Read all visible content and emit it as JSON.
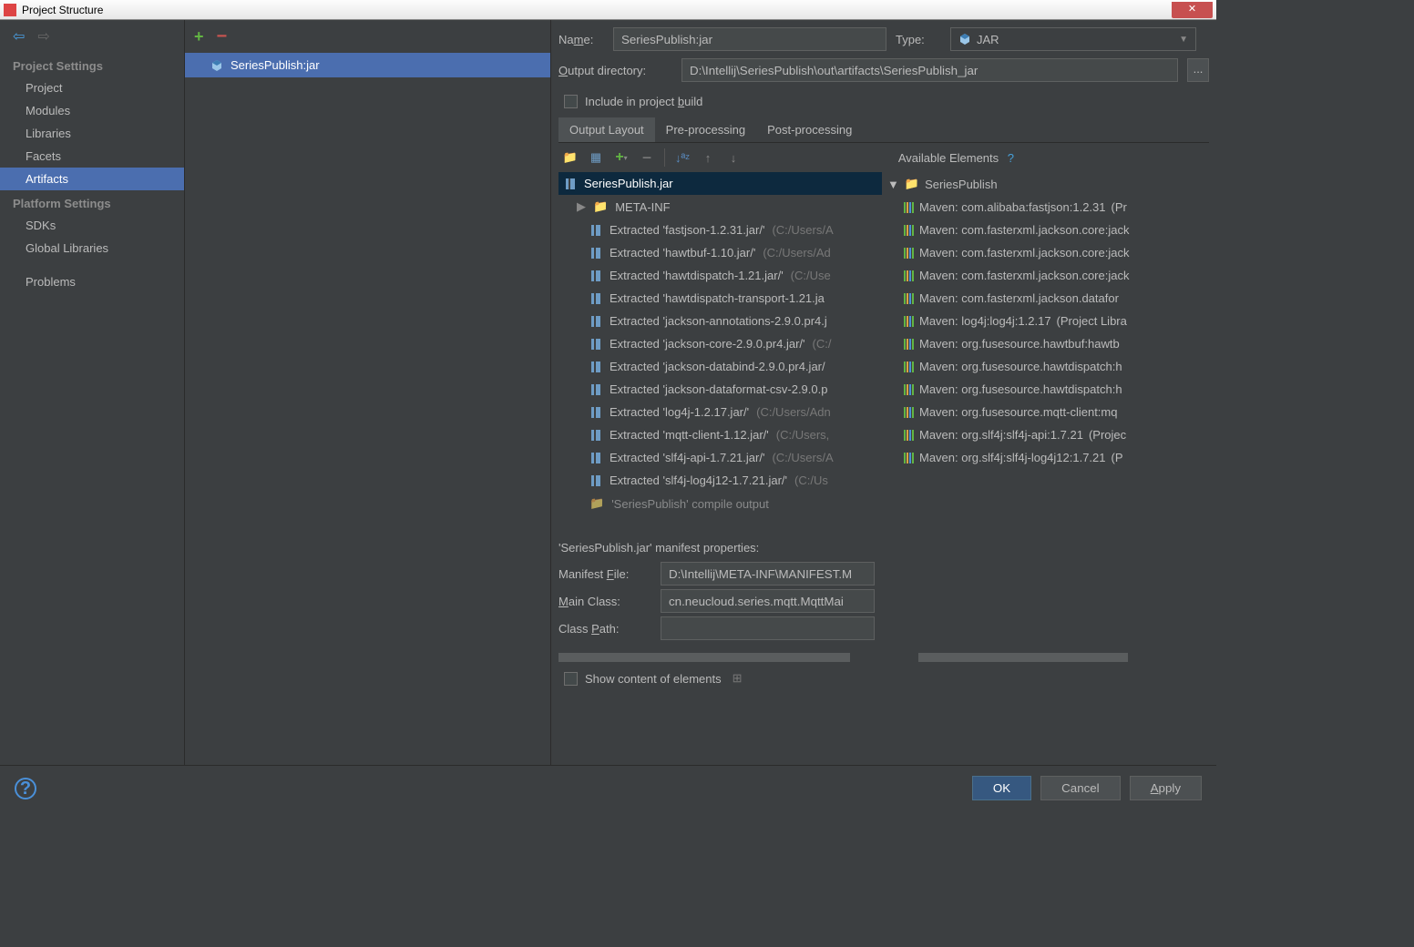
{
  "window": {
    "title": "Project Structure",
    "close": "✕"
  },
  "nav": {
    "back": "⬅",
    "fwd": "➡",
    "section1": "Project Settings",
    "items1": [
      "Project",
      "Modules",
      "Libraries",
      "Facets",
      "Artifacts"
    ],
    "section2": "Platform Settings",
    "items2": [
      "SDKs",
      "Global Libraries"
    ],
    "problems": "Problems"
  },
  "artifacts": {
    "item": "SeriesPublish:jar"
  },
  "form": {
    "nameLabel": "Name:",
    "name": "SeriesPublish:jar",
    "typeLabel": "Type:",
    "type": "JAR",
    "outdirLabel": "Output directory:",
    "outdir": "D:\\Intellij\\SeriesPublish\\out\\artifacts\\SeriesPublish_jar",
    "browse": "...",
    "includeBuild": "Include in project build"
  },
  "tabs": [
    "Output Layout",
    "Pre-processing",
    "Post-processing"
  ],
  "layout": {
    "root": "SeriesPublish.jar",
    "metainf": "META-INF",
    "rows": [
      {
        "t": "Extracted 'fastjson-1.2.31.jar/' ",
        "d": "(C:/Users/A"
      },
      {
        "t": "Extracted 'hawtbuf-1.10.jar/' ",
        "d": "(C:/Users/Ad"
      },
      {
        "t": "Extracted 'hawtdispatch-1.21.jar/' ",
        "d": "(C:/Use"
      },
      {
        "t": "Extracted 'hawtdispatch-transport-1.21.ja",
        "d": ""
      },
      {
        "t": "Extracted 'jackson-annotations-2.9.0.pr4.j",
        "d": ""
      },
      {
        "t": "Extracted 'jackson-core-2.9.0.pr4.jar/' ",
        "d": "(C:/"
      },
      {
        "t": "Extracted 'jackson-databind-2.9.0.pr4.jar/",
        "d": ""
      },
      {
        "t": "Extracted 'jackson-dataformat-csv-2.9.0.p",
        "d": ""
      },
      {
        "t": "Extracted 'log4j-1.2.17.jar/' ",
        "d": "(C:/Users/Adn"
      },
      {
        "t": "Extracted 'mqtt-client-1.12.jar/' ",
        "d": "(C:/Users,"
      },
      {
        "t": "Extracted 'slf4j-api-1.7.21.jar/' ",
        "d": "(C:/Users/A"
      },
      {
        "t": "Extracted 'slf4j-log4j12-1.7.21.jar/' ",
        "d": "(C:/Us"
      }
    ],
    "compileOut": "'SeriesPublish' compile output"
  },
  "available": {
    "header": "Available Elements",
    "root": "SeriesPublish",
    "items": [
      {
        "t": "Maven: com.alibaba:fastjson:1.2.31 ",
        "d": "(Pr"
      },
      {
        "t": "Maven: com.fasterxml.jackson.core:jack",
        "d": ""
      },
      {
        "t": "Maven: com.fasterxml.jackson.core:jack",
        "d": ""
      },
      {
        "t": "Maven: com.fasterxml.jackson.core:jack",
        "d": ""
      },
      {
        "t": "Maven: com.fasterxml.jackson.datafor",
        "d": ""
      },
      {
        "t": "Maven: log4j:log4j:1.2.17 ",
        "d": "(Project Libra"
      },
      {
        "t": "Maven: org.fusesource.hawtbuf:hawtb",
        "d": ""
      },
      {
        "t": "Maven: org.fusesource.hawtdispatch:h",
        "d": ""
      },
      {
        "t": "Maven: org.fusesource.hawtdispatch:h",
        "d": ""
      },
      {
        "t": "Maven: org.fusesource.mqtt-client:mq",
        "d": ""
      },
      {
        "t": "Maven: org.slf4j:slf4j-api:1.7.21 ",
        "d": "(Projec"
      },
      {
        "t": "Maven: org.slf4j:slf4j-log4j12:1.7.21 ",
        "d": "(P"
      }
    ]
  },
  "manifest": {
    "title": "'SeriesPublish.jar' manifest properties:",
    "fileLabel": "Manifest File:",
    "file": "D:\\Intellij\\META-INF\\MANIFEST.M",
    "mainLabel": "Main Class:",
    "main": "cn.neucloud.series.mqtt.MqttMai",
    "cpLabel": "Class Path:",
    "cp": ""
  },
  "showContent": "Show content of elements",
  "footer": {
    "ok": "OK",
    "cancel": "Cancel",
    "apply": "Apply"
  }
}
